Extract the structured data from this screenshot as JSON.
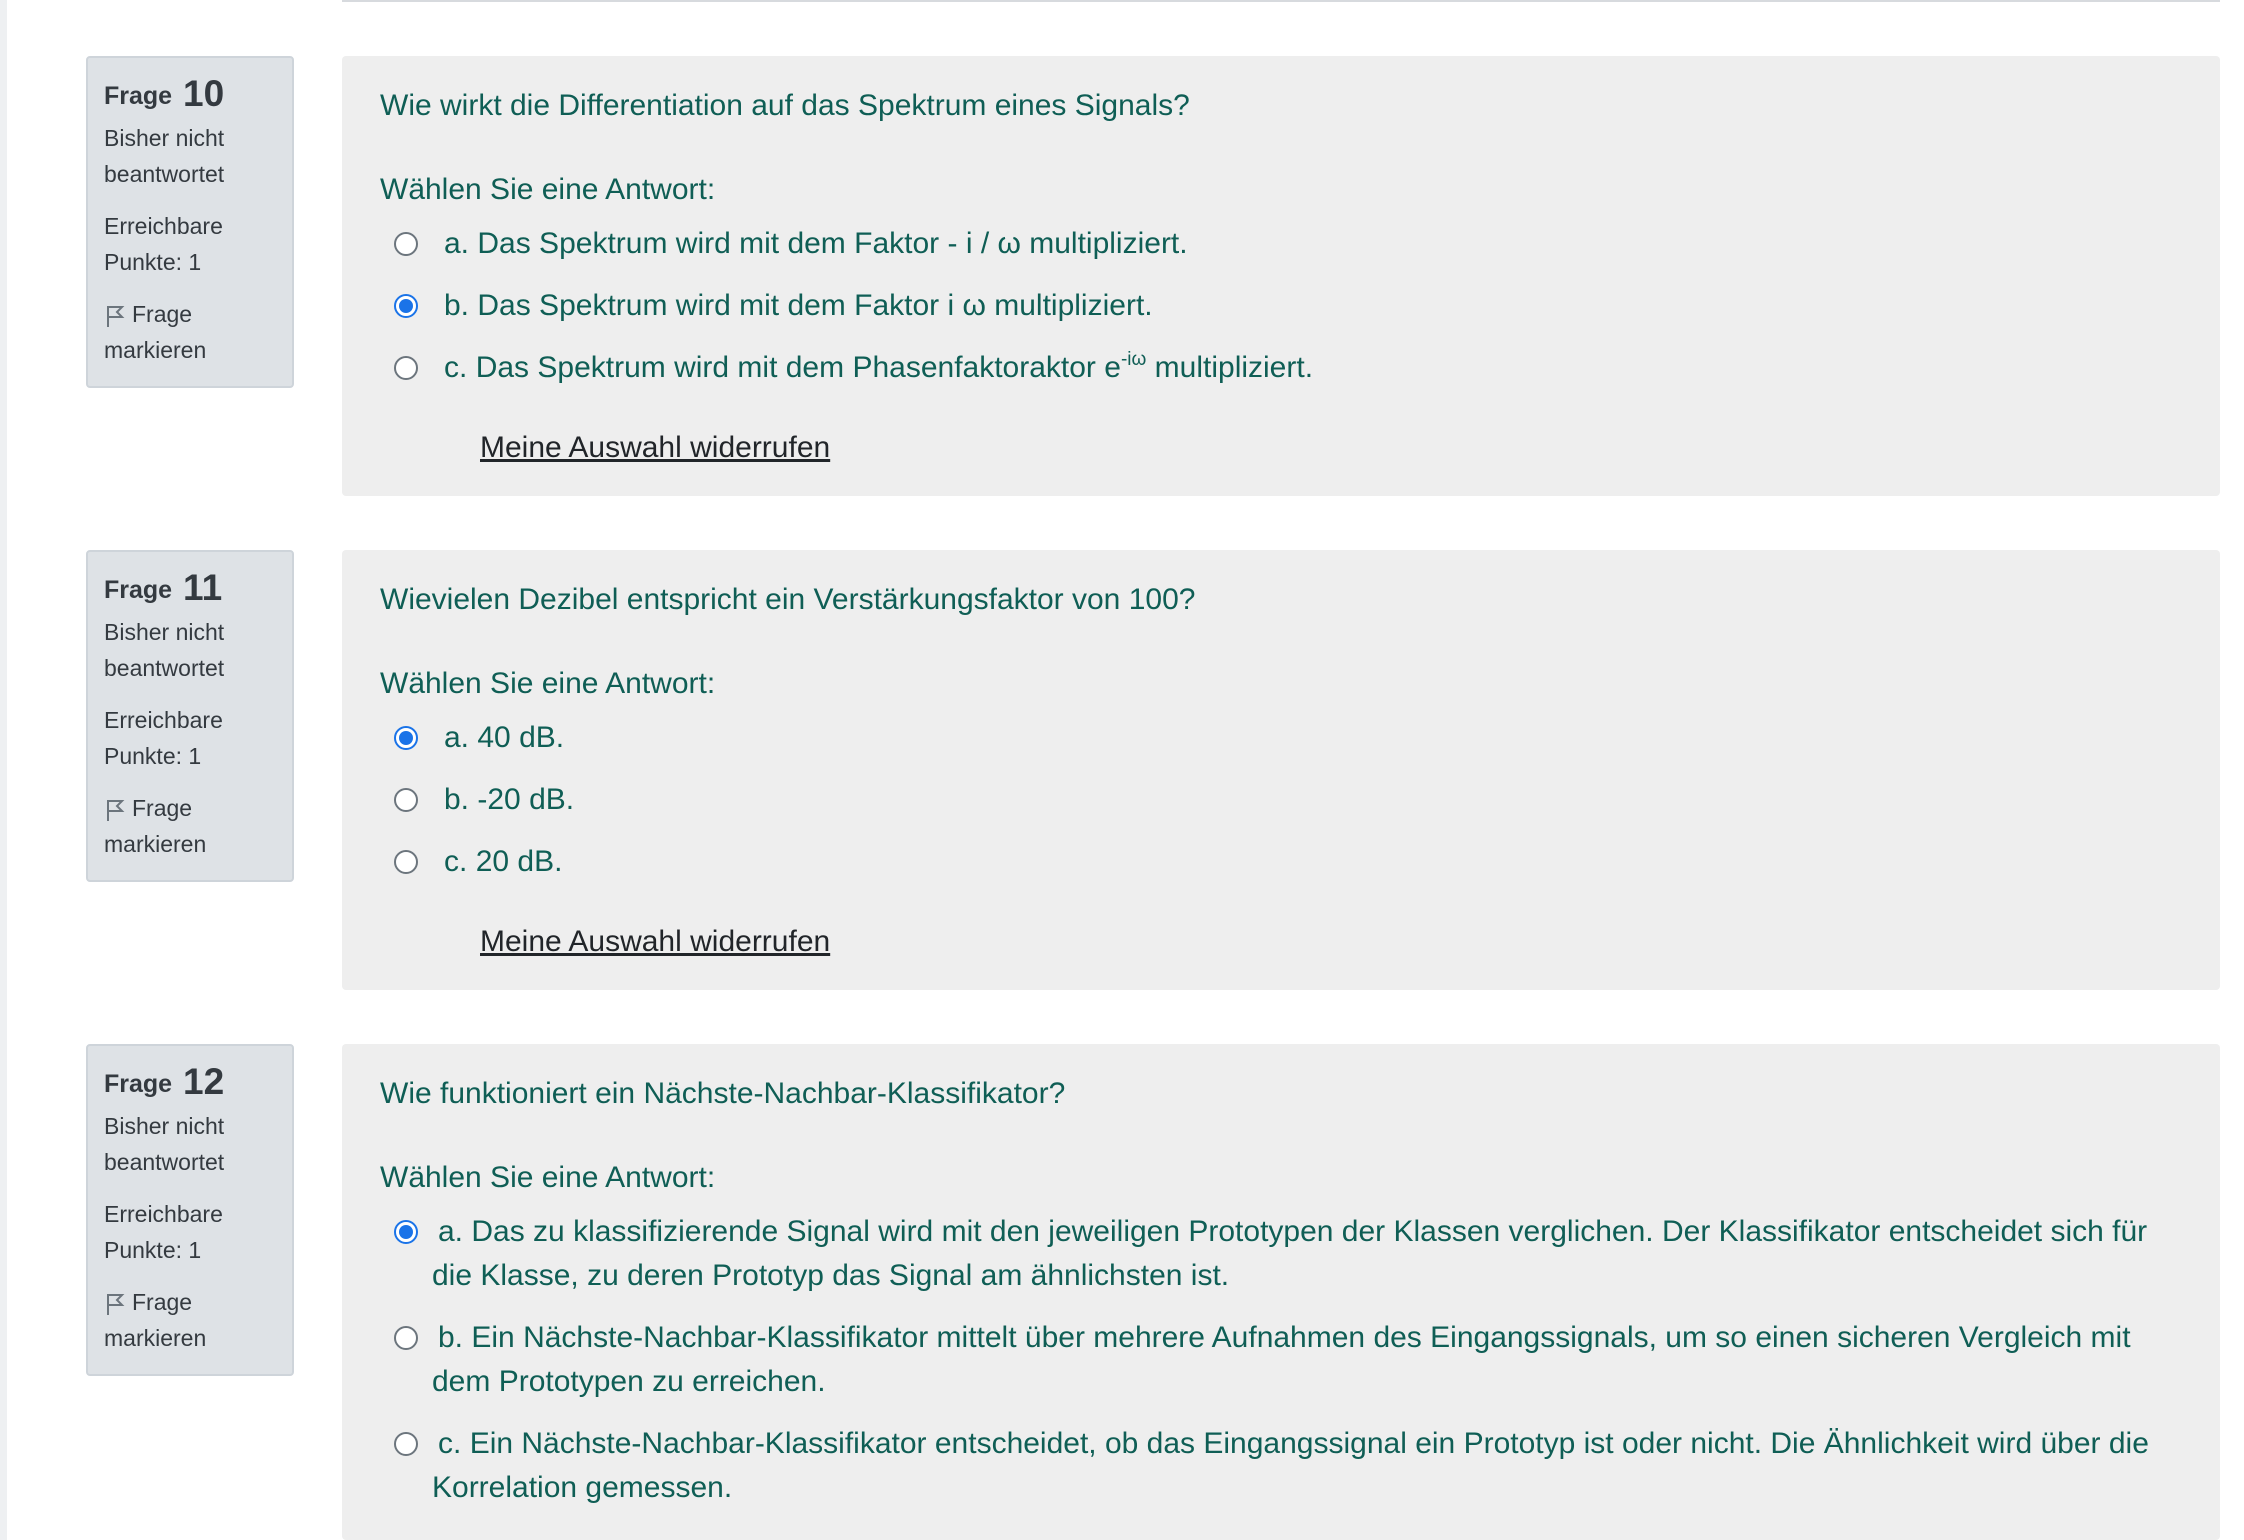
{
  "questions": [
    {
      "label": "Frage",
      "number": "10",
      "state": "Bisher nicht beantwortet",
      "grade": "Erreichbare Punkte: 1",
      "flag_label": "Frage markieren",
      "text": "Wie wirkt die Differentiation auf das Spektrum eines Signals?",
      "prompt": "Wählen Sie eine Antwort:",
      "options": [
        {
          "letter": "a.",
          "text": "Das Spektrum wird mit dem Faktor - i / ω multipliziert.",
          "selected": false
        },
        {
          "letter": "b.",
          "text": "Das Spektrum wird mit dem Faktor i ω multipliziert.",
          "selected": true
        },
        {
          "letter": "c.",
          "text_before": "Das Spektrum wird mit dem Phasenfaktoraktor e",
          "superscript": "-iω",
          "text_after": " multipliziert.",
          "selected": false
        }
      ],
      "clear_label": "Meine Auswahl widerrufen"
    },
    {
      "label": "Frage",
      "number": "11",
      "state": "Bisher nicht beantwortet",
      "grade": "Erreichbare Punkte: 1",
      "flag_label": "Frage markieren",
      "text": "Wievielen Dezibel entspricht ein Verstärkungsfaktor von 100?",
      "prompt": "Wählen Sie eine Antwort:",
      "options": [
        {
          "letter": "a.",
          "text": "40 dB.",
          "selected": true
        },
        {
          "letter": "b.",
          "text": "-20 dB.",
          "selected": false
        },
        {
          "letter": "c.",
          "text": "20 dB.",
          "selected": false
        }
      ],
      "clear_label": "Meine Auswahl widerrufen"
    },
    {
      "label": "Frage",
      "number": "12",
      "state": "Bisher nicht beantwortet",
      "grade": "Erreichbare Punkte: 1",
      "flag_label": "Frage markieren",
      "text": "Wie funktioniert ein Nächste-Nachbar-Klassifikator?",
      "prompt": "Wählen Sie eine Antwort:",
      "options": [
        {
          "letter": "a.",
          "text": "Das zu klassifizierende Signal wird mit den jeweiligen Prototypen der Klassen verglichen. Der Klassifikator entscheidet sich für die Klasse, zu deren Prototyp das Signal am ähnlichsten ist.",
          "selected": true
        },
        {
          "letter": "b.",
          "text": "Ein Nächste-Nachbar-Klassifikator mittelt über mehrere Aufnahmen des Eingangssignals, um so einen sicheren Vergleich mit dem Prototypen zu erreichen.",
          "selected": false
        },
        {
          "letter": "c.",
          "text": "Ein Nächste-Nachbar-Klassifikator entscheidet, ob das Eingangssignal ein Prototyp ist oder nicht. Die Ähnlichkeit wird über die Korrelation gemessen.",
          "selected": false
        }
      ]
    }
  ],
  "colors": {
    "question_text": "#0f5e55",
    "info_background": "#dee2e6",
    "content_background": "#eeeeee",
    "radio_selected": "#1a73e8"
  }
}
